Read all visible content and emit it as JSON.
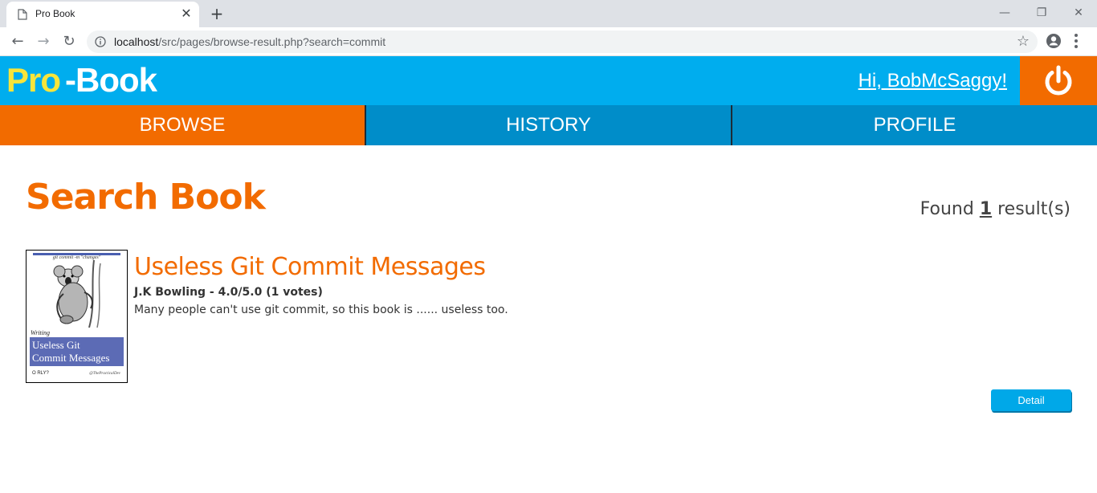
{
  "browser": {
    "tab_title": "Pro Book",
    "tab_close": "✕",
    "new_tab": "+",
    "url_host": "localhost",
    "url_path": "/src/pages/browse-result.php?search=commit",
    "win_minimize": "—",
    "win_restore": "❐",
    "win_close": "✕",
    "back": "←",
    "forward": "→",
    "reload": "↻",
    "bookmark_star": "☆"
  },
  "header": {
    "logo_pro": "Pro",
    "logo_book": "-Book",
    "greeting": "Hi, BobMcSaggy!",
    "logout_icon": "power-icon",
    "bg_color": "#00adee",
    "logout_color": "#f26b00"
  },
  "nav": {
    "tabs": [
      {
        "label": "Browse",
        "active": true
      },
      {
        "label": "History",
        "active": false
      },
      {
        "label": "Profile",
        "active": false
      }
    ]
  },
  "main": {
    "title": "Search Book",
    "found_prefix": "Found",
    "found_count": "1",
    "found_suffix": "result(s)"
  },
  "results": [
    {
      "title": "Useless Git Commit Messages",
      "meta": "J.K Bowling - 4.0/5.0 (1 votes)",
      "description": "Many people can't use git commit, so this book is ...... useless too.",
      "cover": {
        "tagline": "git commit -m \"changes\"",
        "writing": "Writing",
        "box_line1": "Useless Git",
        "box_line2": "Commit Messages",
        "publisher": "O RLY?",
        "handle": "@ThePracticalDev"
      },
      "detail_label": "Detail"
    }
  ]
}
